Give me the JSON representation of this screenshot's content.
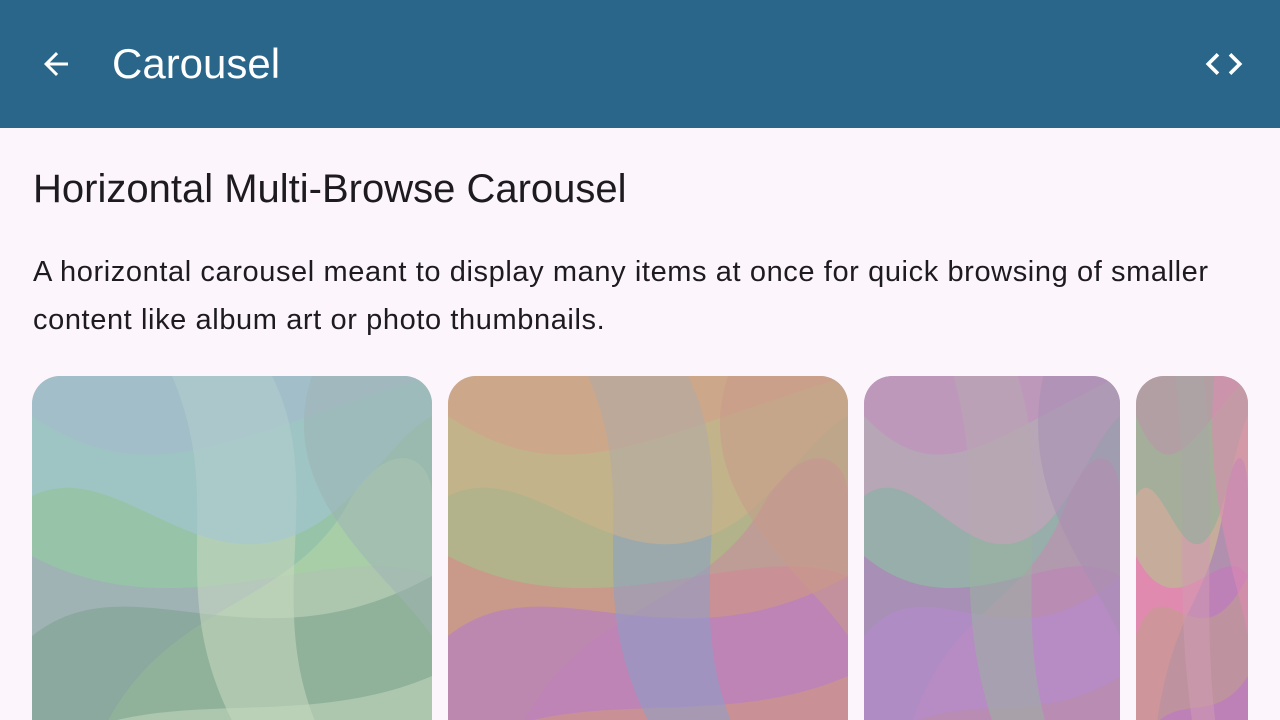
{
  "app_bar": {
    "title": "Carousel",
    "back_icon": "arrow-back-icon",
    "code_icon": "code-icon",
    "background": "#29668a"
  },
  "section": {
    "title": "Horizontal Multi-Browse Carousel",
    "description": "A horizontal carousel meant to display many items at once for quick browsing of smaller content like album art or photo thumbnails."
  },
  "carousel": {
    "items": [
      {
        "name": "carousel-item-1",
        "palette": [
          "#9fb3b5",
          "#8fd19e",
          "#b7d7a8",
          "#7aa08a",
          "#c9d8c0",
          "#a4c7d8"
        ]
      },
      {
        "name": "carousel-item-2",
        "palette": [
          "#c99a8a",
          "#9fc98a",
          "#c98aa0",
          "#b37ad0",
          "#8aa0c9",
          "#d0b38a"
        ]
      },
      {
        "name": "carousel-item-3",
        "palette": [
          "#a78fb5",
          "#8ac9a0",
          "#c98ab0",
          "#b78ad0",
          "#9ab3a0",
          "#d0a0c0"
        ]
      },
      {
        "name": "carousel-item-4",
        "palette": [
          "#e08ab0",
          "#b0c98a",
          "#a07ac0",
          "#c0a08a",
          "#d09ab0",
          "#8ab09a"
        ]
      }
    ]
  }
}
